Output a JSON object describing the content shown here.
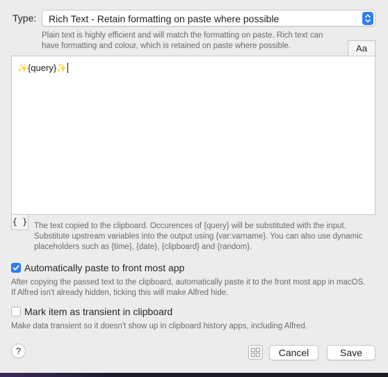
{
  "type_row": {
    "label": "Type:",
    "selected": "Rich Text - Retain formatting on paste where possible"
  },
  "type_description": "Plain text is highly efficient and will match the formatting on paste. Rich text can have formatting and colour, which is retained on paste where possible.",
  "font_button_label": "Aa",
  "editor": {
    "sparkle_left": "✨",
    "text": "{query}",
    "sparkle_right": "✨"
  },
  "placeholder_button_label": "{ }",
  "clipboard_description": "The text copied to the clipboard. Occurences of {query} will be substituted with the input. Substitute upstream variables into the output using {var:varname}. You can also use dynamic placeholders such as {time}, {date}, {clipboard} and {random}.",
  "auto_paste": {
    "label": "Automatically paste to front most app",
    "checked": true,
    "description": "After copying the passed text to the clipboard, automatically paste it to the front most app in macOS. If Alfred isn't already hidden, ticking this will make Alfred hide."
  },
  "transient": {
    "label": "Mark item as transient in clipboard",
    "checked": false,
    "description": "Make data transient so it doesn't show up in clipboard history apps, including Alfred."
  },
  "footer": {
    "help_label": "?",
    "cancel_label": "Cancel",
    "save_label": "Save"
  },
  "icons": {
    "select_stepper": "chevron-updown-icon",
    "checkbox_check": "checkmark-icon",
    "grid": "grid-icon"
  },
  "colors": {
    "accent": "#2f7cf6",
    "sparkle": "#f3c93c",
    "window_bg": "#ececec"
  }
}
